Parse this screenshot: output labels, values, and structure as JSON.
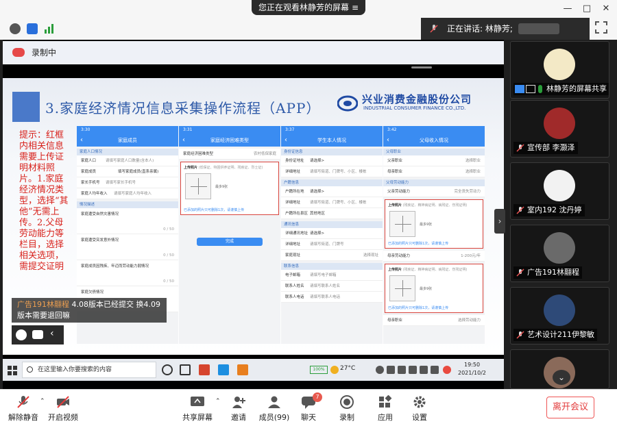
{
  "banner": {
    "viewing_text": "您正在观看林静芳的屏幕",
    "window_controls": [
      "minimize",
      "maximize",
      "close"
    ]
  },
  "speaking": {
    "label": "正在讲话: 林静芳;"
  },
  "recording": {
    "label": "录制中"
  },
  "slide": {
    "title": "3.家庭经济情况信息采集操作流程（APP）",
    "company_cn": "兴业消费金融股份公司",
    "company_en": "INDUSTRIAL CONSUMER FINANCE CO.,LTD.",
    "hint": "提示：红框内相关信息需要上传证明材料照片。1.家庭经济情况类型，选择“其他”无需上传。2.父母劳动能力等栏目，选择相关选项，需提交证明"
  },
  "phones": [
    {
      "time": "3:30",
      "title": "家庭成员",
      "rows": [
        {
          "label": "家庭人口",
          "value": "请填写家庭人口数量(含本人)"
        },
        {
          "label": "家庭成员",
          "value": "填写家庭成员(直系亲属)"
        },
        {
          "label": "家长手机号",
          "value": "请填写家长手机号"
        },
        {
          "label": "家庭人均年收入",
          "value": "请填写家庭人均年收入"
        }
      ],
      "section": "情况描述",
      "textareas": [
        {
          "label": "家庭遭受自然灾害情况",
          "count": "0 / 50"
        },
        {
          "label": "家庭遭受突发意外情况",
          "count": "0 / 50"
        },
        {
          "label": "家庭成员因残疾、年迈而劳动能力弱情况",
          "count": "0 / 50"
        },
        {
          "label": "家庭欠债情况",
          "count": ""
        }
      ]
    },
    {
      "time": "3:31",
      "title": "家庭经济困难类型",
      "rows": [
        {
          "label": "家庭经济困难类型",
          "value": "农村低保家庭"
        }
      ],
      "upload_label": "上传照片",
      "upload_hint": "(低保证、特困供养证明、残疾证、烈士证)",
      "upload_limit": "最多9张",
      "upload_note": "已添加的照片只可删除1次，请谨慎上传",
      "button": "完成"
    },
    {
      "time": "3:37",
      "title": "学生本人情况",
      "rows": [
        {
          "label": "身份证地址",
          "value": "请选择>"
        },
        {
          "label": "详细地址",
          "value": "请填写街道、门牌号、小区、楼栋"
        },
        {
          "label": "户籍所在地",
          "value": "请选择>"
        },
        {
          "label": "详细地址",
          "value": "请填写街道、门牌号、小区、楼栋"
        },
        {
          "label": "户籍所在县区",
          "value": "其他地区"
        },
        {
          "label": "详细通讯地址",
          "value": "请选择>"
        },
        {
          "label": "详细地址",
          "value": "请填写街道、门牌号"
        },
        {
          "label": "家庭现址",
          "value": "选择现址"
        },
        {
          "label": "电子邮箱",
          "value": "请填写电子邮箱"
        },
        {
          "label": "联系人姓名",
          "value": "请填写联系人姓名"
        },
        {
          "label": "联系人电话",
          "value": "请填写联系人电话"
        }
      ]
    },
    {
      "time": "3:42",
      "title": "父母收入情况",
      "rows": [
        {
          "label": "父亲职业",
          "value": "选择职业"
        },
        {
          "label": "母亲职业",
          "value": "选择职业"
        },
        {
          "label": "父亲劳动能力",
          "value": "完全丧失劳动力"
        },
        {
          "label": "母亲劳动能力",
          "value": "1-200元/年"
        },
        {
          "label": "母亲职业",
          "value": "选择劳动能力"
        }
      ],
      "upload_label": "上传照片",
      "upload_hint": "(残疾证、精神病证明、病残证、伤残证明)",
      "upload_limit": "最多9张",
      "upload_note": "已添加的照片只可删除1次，请谨慎上传"
    }
  ],
  "chat_toast": {
    "sender": "广告191林翮程",
    "message_1": "4.08版本已经提交 换4.09",
    "message_2": "版本需要退回嘛"
  },
  "taskbar": {
    "search_placeholder": "在这里输入你要搜索的内容",
    "battery": "100%",
    "weather": "27°C",
    "time": "19:50",
    "date": "2021/10/2"
  },
  "participants": [
    {
      "name": "林静芳的屏幕共享",
      "muted": false
    },
    {
      "name": "宣传部 李灏泽",
      "muted": true
    },
    {
      "name": "室内192 沈丹婷",
      "muted": true
    },
    {
      "name": "广告191林翮程",
      "muted": true
    },
    {
      "name": "艺术设计211伊黎敏",
      "muted": true
    },
    {
      "name": "",
      "muted": false
    }
  ],
  "toolbar": {
    "unmute": "解除静音",
    "start_video": "开启视频",
    "share_screen": "共享屏幕",
    "invite": "邀请",
    "members": "成员(99)",
    "chat": "聊天",
    "chat_badge": "7",
    "record": "录制",
    "apps": "应用",
    "settings": "设置",
    "leave": "离开会议"
  },
  "colors": {
    "accent_blue": "#3a8cf2",
    "leave_red": "#e23b3b",
    "hint_red": "#d8221c"
  }
}
